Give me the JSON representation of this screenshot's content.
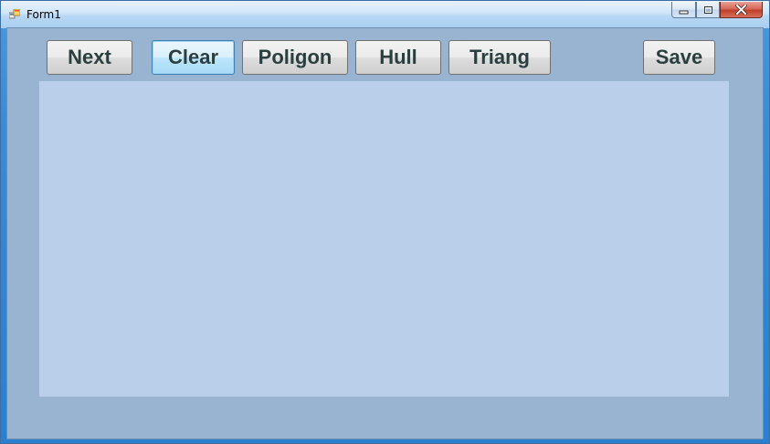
{
  "window": {
    "title": "Form1"
  },
  "toolbar": {
    "buttons": [
      {
        "label": "Next"
      },
      {
        "label": "Clear"
      },
      {
        "label": "Poligon"
      },
      {
        "label": "Hull"
      },
      {
        "label": "Triang"
      },
      {
        "label": "Save"
      }
    ],
    "focused": "Clear"
  },
  "icons": {
    "app": "form-app-icon",
    "minimize": "minimize-icon",
    "maximize": "maximize-icon",
    "close": "close-icon"
  },
  "colors": {
    "client_background": "#99b4d1",
    "drawing_area": "#b9cfea",
    "close_button": "#c8432f"
  }
}
